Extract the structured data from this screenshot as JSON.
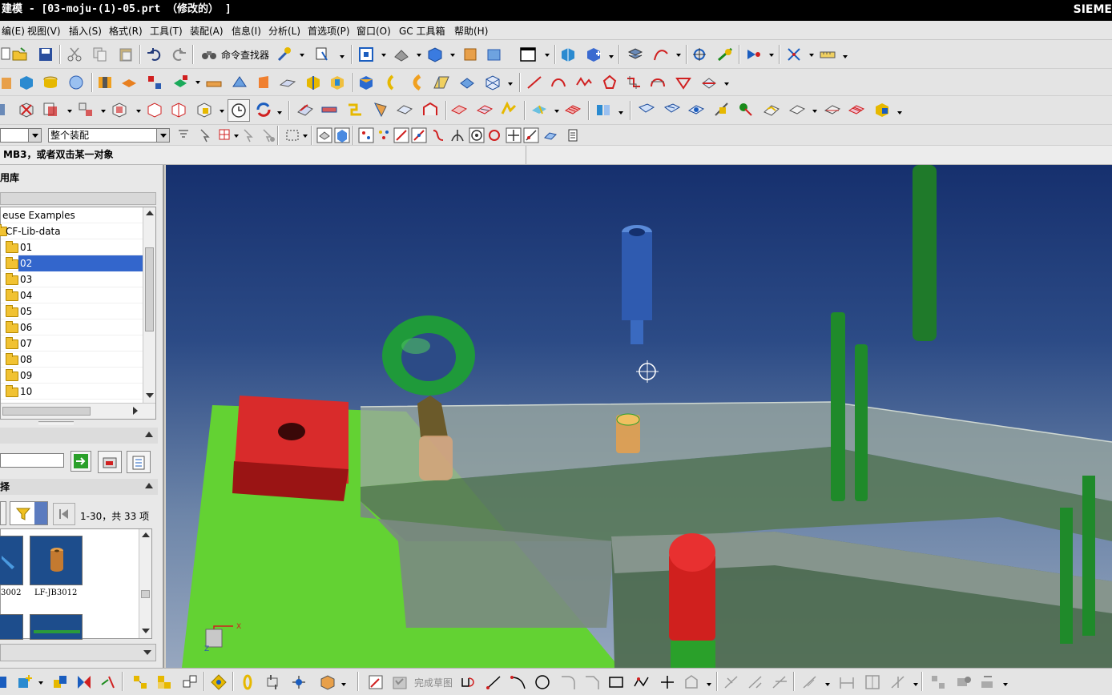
{
  "window": {
    "title": "建模 - [03-moju-(1)-05.prt （修改的） ]",
    "brand": "SIEME"
  },
  "menu": [
    "编(E)",
    "视图(V)",
    "插入(S)",
    "格式(R)",
    "工具(T)",
    "装配(A)",
    "信息(I)",
    "分析(L)",
    "首选项(P)",
    "窗口(O)",
    "GC 工具箱",
    "帮助(H)"
  ],
  "toolbar": {
    "command_finder": "命令查找器",
    "finish_sketch": "完成草图"
  },
  "selection": {
    "filter_value": "",
    "scope_value": "整个装配"
  },
  "cue_line": "MB3，或者双击某一对象",
  "resource_panel": {
    "title": "用库",
    "tree": [
      {
        "label": "euse Examples",
        "level": 0,
        "folder": false
      },
      {
        "label": "CF-Lib-data",
        "level": 1,
        "folder": true
      },
      {
        "label": "01",
        "level": 2,
        "folder": true
      },
      {
        "label": "02",
        "level": 2,
        "folder": true,
        "selected": true
      },
      {
        "label": "03",
        "level": 2,
        "folder": true
      },
      {
        "label": "04",
        "level": 2,
        "folder": true
      },
      {
        "label": "05",
        "level": 2,
        "folder": true
      },
      {
        "label": "06",
        "level": 2,
        "folder": true
      },
      {
        "label": "07",
        "level": 2,
        "folder": true
      },
      {
        "label": "08",
        "level": 2,
        "folder": true
      },
      {
        "label": "09",
        "level": 2,
        "folder": true
      },
      {
        "label": "10",
        "level": 2,
        "folder": true
      }
    ],
    "search_section_title": "",
    "search_value": "",
    "results_title": "择",
    "page_info": "1-30，共 33 项",
    "results": [
      {
        "caption": "3002"
      },
      {
        "caption": "LF-JB3012"
      }
    ]
  },
  "triad": {
    "x_label": "X",
    "z_label": "Z"
  },
  "colors": {
    "selected_row": "#3366cc",
    "viewport_top": "#16306e",
    "viewport_bottom": "#97a7bf",
    "plate_green": "#63d233",
    "block_red": "#d92b2b",
    "ring_green": "#1f9a3a"
  }
}
